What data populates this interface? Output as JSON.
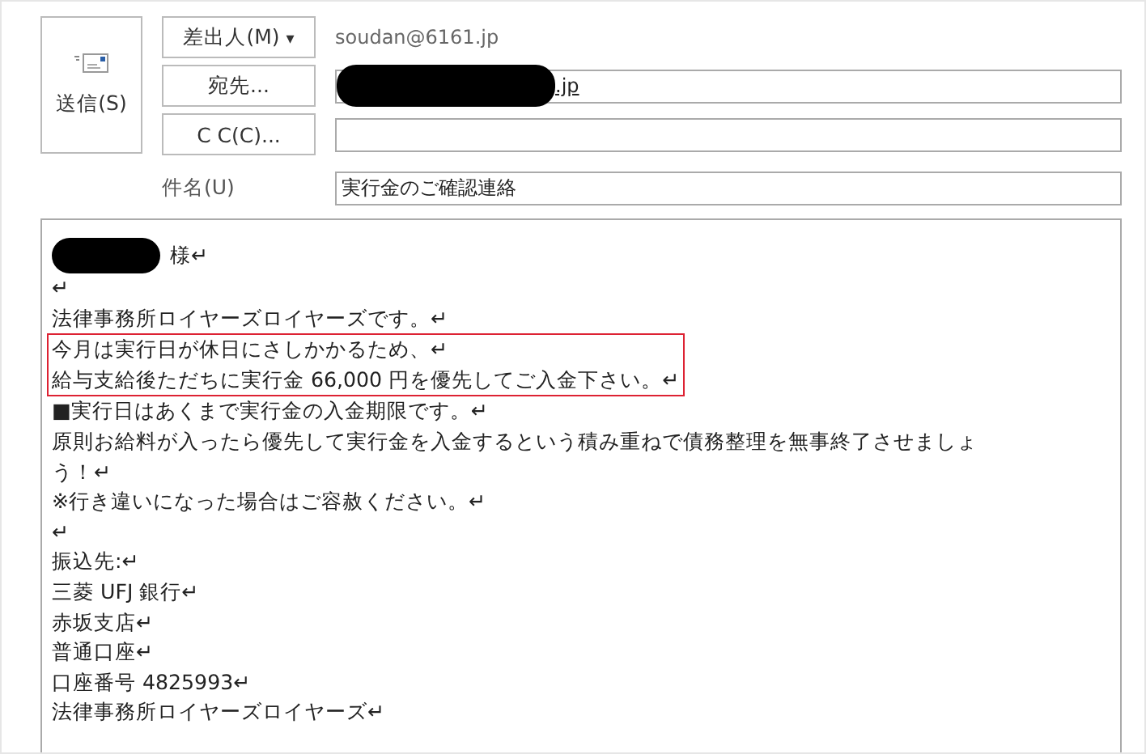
{
  "send_button": {
    "label": "送信(S)"
  },
  "from": {
    "button": "差出人(M)",
    "caret": "▾",
    "address": "soudan@6161.jp"
  },
  "to": {
    "button": "宛先...",
    "value": ".jp",
    "redacted": true
  },
  "cc": {
    "button": "C C(C)..."
  },
  "subject": {
    "label": "件名(U)",
    "value": "実行金のご確認連絡"
  },
  "body": {
    "lines": [
      {
        "kind": "redacted_name",
        "text": "様↵",
        "highlighted": false
      },
      {
        "kind": "text",
        "text": "↵",
        "highlighted": false
      },
      {
        "kind": "text",
        "text": "法律事務所ロイヤーズロイヤーズです。↵",
        "highlighted": false
      },
      {
        "kind": "text",
        "text": "今月は実行日が休日にさしかかるため、↵",
        "highlighted": true
      },
      {
        "kind": "text",
        "text": "給与支給後ただちに実行金 66,000 円を優先してご入金下さい。↵",
        "highlighted": true
      },
      {
        "kind": "text",
        "text": "■実行日はあくまで実行金の入金期限です。↵",
        "highlighted": false
      },
      {
        "kind": "text",
        "text": "原則お給料が入ったら優先して実行金を入金するという積み重ねで債務整理を無事終了させましょ",
        "highlighted": false
      },
      {
        "kind": "text",
        "text": "う！↵",
        "highlighted": false
      },
      {
        "kind": "text",
        "text": "※行き違いになった場合はご容赦ください。↵",
        "highlighted": false
      },
      {
        "kind": "text",
        "text": "↵",
        "highlighted": false
      },
      {
        "kind": "text",
        "text": "振込先:↵",
        "highlighted": false
      },
      {
        "kind": "text",
        "text": "三菱 UFJ 銀行↵",
        "highlighted": false
      },
      {
        "kind": "text",
        "text": "赤坂支店↵",
        "highlighted": false
      },
      {
        "kind": "text",
        "text": "普通口座↵",
        "highlighted": false
      },
      {
        "kind": "text",
        "text": "口座番号 4825993↵",
        "highlighted": false
      },
      {
        "kind": "text",
        "text": "法律事務所ロイヤーズロイヤーズ↵",
        "highlighted": false
      }
    ]
  }
}
